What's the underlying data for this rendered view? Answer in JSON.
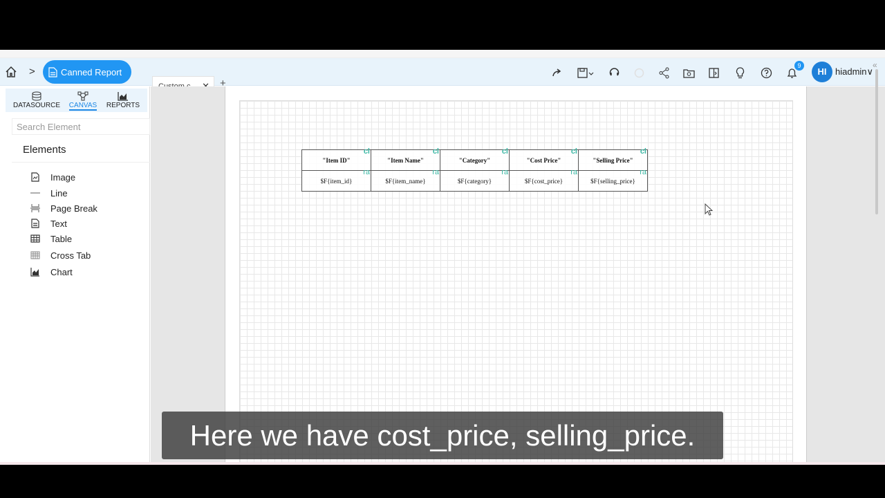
{
  "navbar": {
    "breadcrumb_label": "Canned Report",
    "tab_label": "Custom c...",
    "notification_count": "9",
    "avatar_initials": "HI",
    "username": "hiadmin"
  },
  "sidebar": {
    "tabs": [
      {
        "label": "DATASOURCE",
        "icon": "database-icon"
      },
      {
        "label": "CANVAS",
        "icon": "canvas-icon",
        "active": true
      },
      {
        "label": "REPORTS",
        "icon": "chart-icon"
      }
    ],
    "search_placeholder": "Search Element",
    "elements_title": "Elements",
    "elements": [
      {
        "label": "Image",
        "icon": "image-icon"
      },
      {
        "label": "Line",
        "icon": "line-icon"
      },
      {
        "label": "Page Break",
        "icon": "page-break-icon"
      },
      {
        "label": "Text",
        "icon": "text-icon"
      },
      {
        "label": "Table",
        "icon": "table-icon"
      },
      {
        "label": "Cross Tab",
        "icon": "cross-tab-icon"
      },
      {
        "label": "Chart",
        "icon": "chart-icon"
      }
    ]
  },
  "report_table": {
    "headers": [
      "\"Item ID\"",
      "\"Item Name\"",
      "\"Category\"",
      "\"Cost Price\"",
      "\"Selling Price\""
    ],
    "fields": [
      "$F{item_id}",
      "$F{item_name}",
      "$F{category}",
      "$F{cost_price}",
      "$F{selling_price}"
    ],
    "header_tag": "cl",
    "field_tag": "ra",
    "tag_color": "#3cb8a5"
  },
  "subtitle": "Here we have cost_price, selling_price.",
  "colors": {
    "accent": "#2196f3",
    "navbar_bg": "#e8f3fb"
  }
}
